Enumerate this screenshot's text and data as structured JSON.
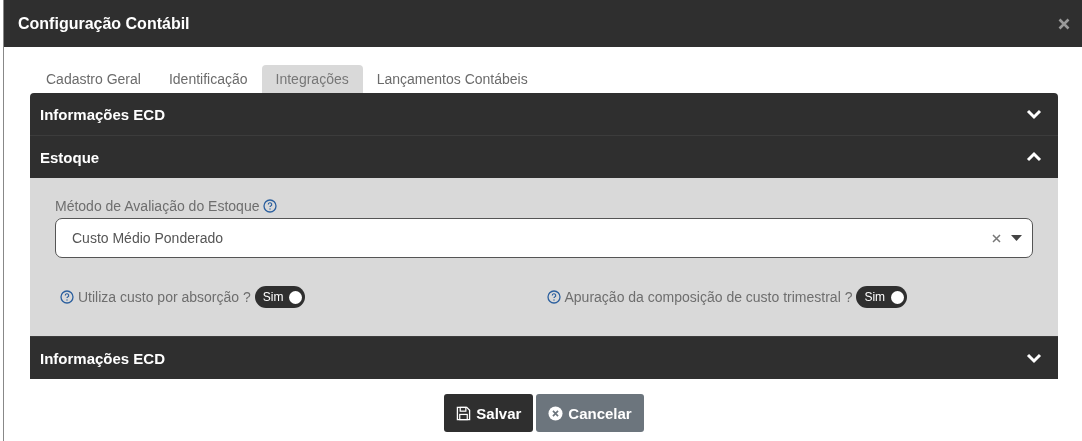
{
  "window": {
    "title": "Configuração Contábil"
  },
  "tabs": [
    {
      "label": "Cadastro Geral",
      "selected": false
    },
    {
      "label": "Identificação",
      "selected": false
    },
    {
      "label": "Integrações",
      "selected": true
    },
    {
      "label": "Lançamentos Contábeis",
      "selected": false
    }
  ],
  "panels": [
    {
      "title": "Informações ECD",
      "expanded": false
    },
    {
      "title": "Estoque",
      "expanded": true,
      "field": {
        "label": "Método de Avaliação do Estoque",
        "value": "Custo Médio Ponderado"
      },
      "toggles": [
        {
          "label": "Utiliza custo por absorção ?",
          "text": "Sim",
          "on": true
        },
        {
          "label": "Apuração da composição de custo trimestral ?",
          "text": "Sim",
          "on": true
        }
      ]
    },
    {
      "title": "Informações ECD",
      "expanded": false
    }
  ],
  "buttons": [
    {
      "label": "Salvar",
      "kind": "save"
    },
    {
      "label": "Cancelar",
      "kind": "cancel"
    }
  ]
}
